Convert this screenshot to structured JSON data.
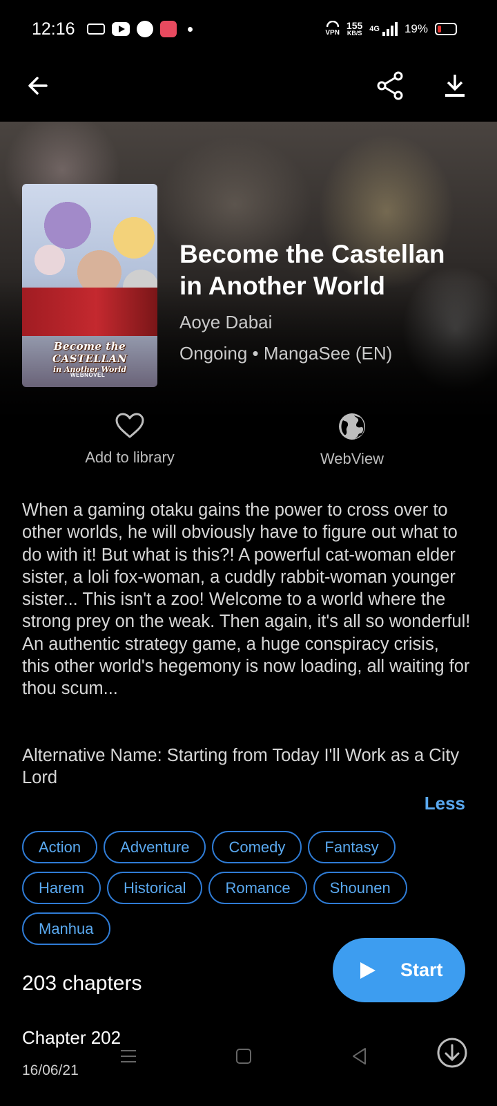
{
  "status_bar": {
    "time": "12:16",
    "vpn_label": "VPN",
    "net_speed": "155",
    "net_unit": "KB/S",
    "network": "4G",
    "battery": "19%"
  },
  "app_bar": {
    "back_icon": "arrow-left-icon",
    "share_icon": "share-icon",
    "download_icon": "download-icon"
  },
  "manga": {
    "title": "Become the Castellan in Another World",
    "author": "Aoye Dabai",
    "status_source": "Ongoing • MangaSee (EN)",
    "cover_text_1": "Become the CASTELLAN",
    "cover_text_2": "in Another World",
    "cover_publisher": "WEBNOVEL",
    "description": "When a gaming otaku gains the power to cross over to other worlds, he will obviously have to figure out what to do with it! But what is this?! A powerful cat-woman elder sister, a loli fox-woman, a cuddly rabbit-woman younger sister... This isn't a zoo! Welcome to a world where the strong prey on the weak. Then again, it's all so wonderful! An authentic strategy game, a huge conspiracy crisis, this other world's hegemony is now loading, all waiting for thou scum...",
    "alternative_name": "Alternative Name: Starting from Today I'll Work as a City Lord",
    "less_label": "Less"
  },
  "actions": {
    "library_label": "Add to library",
    "webview_label": "WebView"
  },
  "genres": [
    "Action",
    "Adventure",
    "Comedy",
    "Fantasy",
    "Harem",
    "Historical",
    "Romance",
    "Shounen",
    "Manhua"
  ],
  "chapters": {
    "count_label": "203 chapters",
    "start_label": "Start",
    "list": [
      {
        "name": "Chapter 202",
        "date": "16/06/21"
      }
    ]
  },
  "colors": {
    "accent": "#3d9df0",
    "tag_border": "#2f7cd6",
    "background": "#000000"
  }
}
